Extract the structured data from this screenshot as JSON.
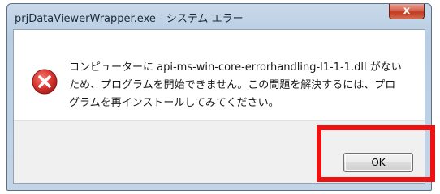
{
  "window": {
    "title": "prjDataViewerWrapper.exe - システム エラー",
    "close_label": "x"
  },
  "dialog": {
    "icon": "error-icon",
    "message_line1": "コンピューターに api-ms-win-core-errorhandling-l1-1-1.dll がない",
    "message_line2": "ため、プログラムを開始できません。この問題を解決するには、プロ",
    "message_line3": "グラムを再インストールしてみてください。",
    "ok_label": "OK"
  },
  "annotation": {
    "highlight_color": "#ee1111"
  },
  "colors": {
    "error_icon": "#d8332f",
    "close_button": "#c13a22"
  }
}
